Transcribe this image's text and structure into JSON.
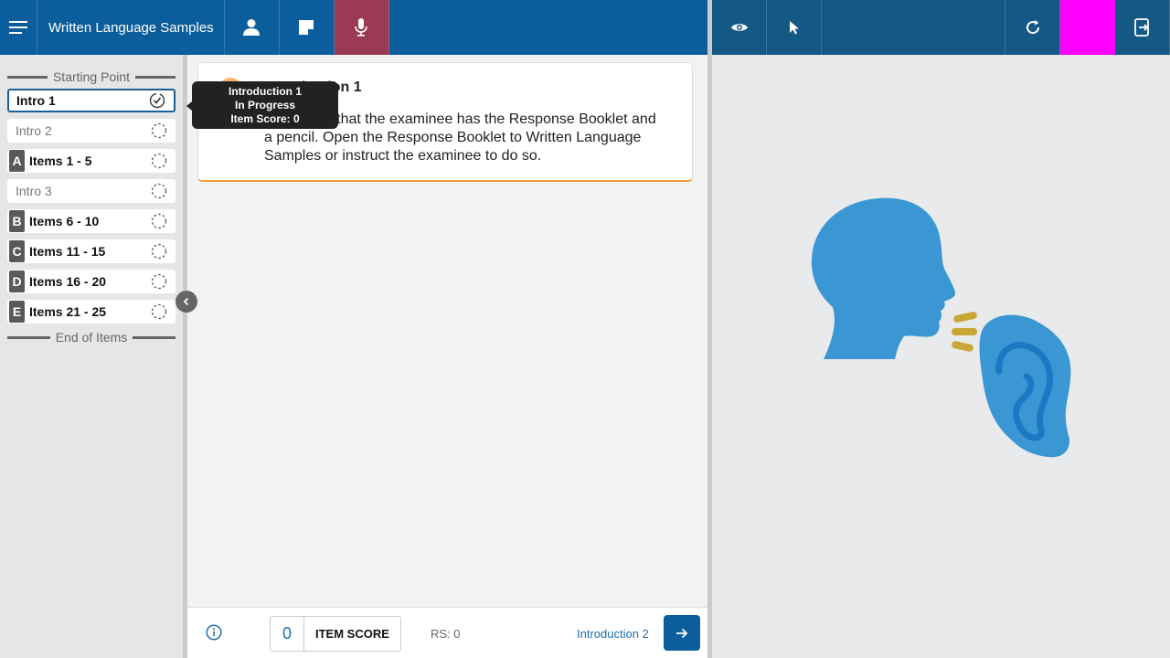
{
  "header": {
    "title": "Written Language Samples",
    "icons": [
      "menu-icon",
      "person-icon",
      "note-icon",
      "microphone-icon",
      "eye-icon",
      "pointer-icon",
      "refresh-icon",
      "exit-icon"
    ]
  },
  "sidebar": {
    "start_label": "Starting Point",
    "end_label": "End of Items",
    "items": [
      {
        "letter": "",
        "label": "Intro 1",
        "active": true
      },
      {
        "letter": "",
        "label": "Intro 2"
      },
      {
        "letter": "A",
        "label": "Items 1 - 5"
      },
      {
        "letter": "",
        "label": "Intro 3"
      },
      {
        "letter": "B",
        "label": "Items 6 - 10"
      },
      {
        "letter": "C",
        "label": "Items 11 - 15"
      },
      {
        "letter": "D",
        "label": "Items 16 - 20"
      },
      {
        "letter": "E",
        "label": "Items 21 - 25"
      }
    ]
  },
  "tooltip": {
    "line1": "Introduction 1",
    "line2": "In Progress",
    "line3": "Item Score: 0"
  },
  "card": {
    "title": "Introduction 1",
    "text": "Make sure that the examinee has the Response Booklet and a pencil. Open the Response Booklet to Written Language Samples or instruct the examinee to do so."
  },
  "footer": {
    "score_value": "0",
    "score_label": "ITEM SCORE",
    "rs_label": "RS: 0",
    "next_label": "Introduction 2"
  },
  "colors": {
    "header": "#0c5d9c",
    "header_right": "#145886",
    "mic_active": "#9a3a55",
    "magenta": "#ff00ff",
    "illustration_blue": "#3b97d3",
    "sound_waves": "#c9a635"
  }
}
